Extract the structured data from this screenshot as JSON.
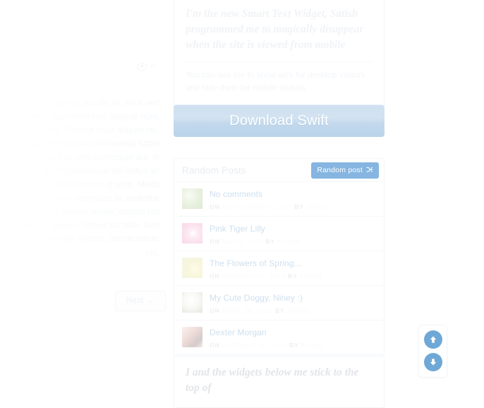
{
  "left_column": {
    "meta": {
      "icon": "eye-icon",
      "views": "0"
    },
    "article_text": "consectetur ac, iaculis ac, eros sed malesuada diam eros nec tempus nunc diam quis est. Proin ut risus aliquet vel, sagittis ac, elementum malesuada turpis ut lacus. Sed ut sem consequat dui, in viverra ac. Pellentesque vel lectus ac quam ligula imperdiet est at ante. Morbi felis eros sapien, venenatis at, molestie id, ut nisl ac blandit mollis, mauris leo ultricies id aliquet. Donec eu nibh. Sed libero nec convallis ornare, consectetuer vel,",
    "next_label": "Next  →"
  },
  "smart_text_widget": {
    "heading": "I'm the new Smart Text Widget, Satish programmed me to magically disappear when the site is viewed from mobile",
    "body": "You can use me to show ad's for desktop visitors and hide them for mobile visitors."
  },
  "download_button": {
    "label": "Download Swift"
  },
  "random_posts": {
    "title": "Random Posts",
    "button_label": "Random post",
    "button_icon": "shuffle-icon",
    "button_color": "#85b5e0",
    "items": [
      {
        "title": "No comments",
        "on_label": "ON",
        "date": "SEPTEMBER 4, 2007",
        "by_label": "BY",
        "author": "ADMIN",
        "thumb": "thumb-green"
      },
      {
        "title": "Pink Tiger Lilly",
        "on_label": "ON",
        "date": "MAY 1, 2011",
        "by_label": "BY",
        "author": "ADMIN",
        "thumb": "thumb-pink"
      },
      {
        "title": "The Flowers of Spring...",
        "on_label": "ON",
        "date": "JANUARY 27, 2010",
        "by_label": "BY",
        "author": "ADMIN",
        "thumb": "thumb-yellow"
      },
      {
        "title": "My Cute Doggy, Niney :)",
        "on_label": "ON",
        "date": "APRIL 28, 2011",
        "by_label": "BY",
        "author": "ADMIN",
        "thumb": "thumb-dog"
      },
      {
        "title": "Dexter Morgan",
        "on_label": "ON",
        "date": "OCTOBER 26, 2011",
        "by_label": "BY",
        "author": "ADMIN",
        "thumb": "thumb-people"
      }
    ]
  },
  "sticky_notice": {
    "text": "I and the widgets below me stick to the top of"
  },
  "scroll_controls": {
    "up_icon": "arrow-up-icon",
    "down_icon": "arrow-down-icon",
    "color": "#6fa8d6"
  }
}
